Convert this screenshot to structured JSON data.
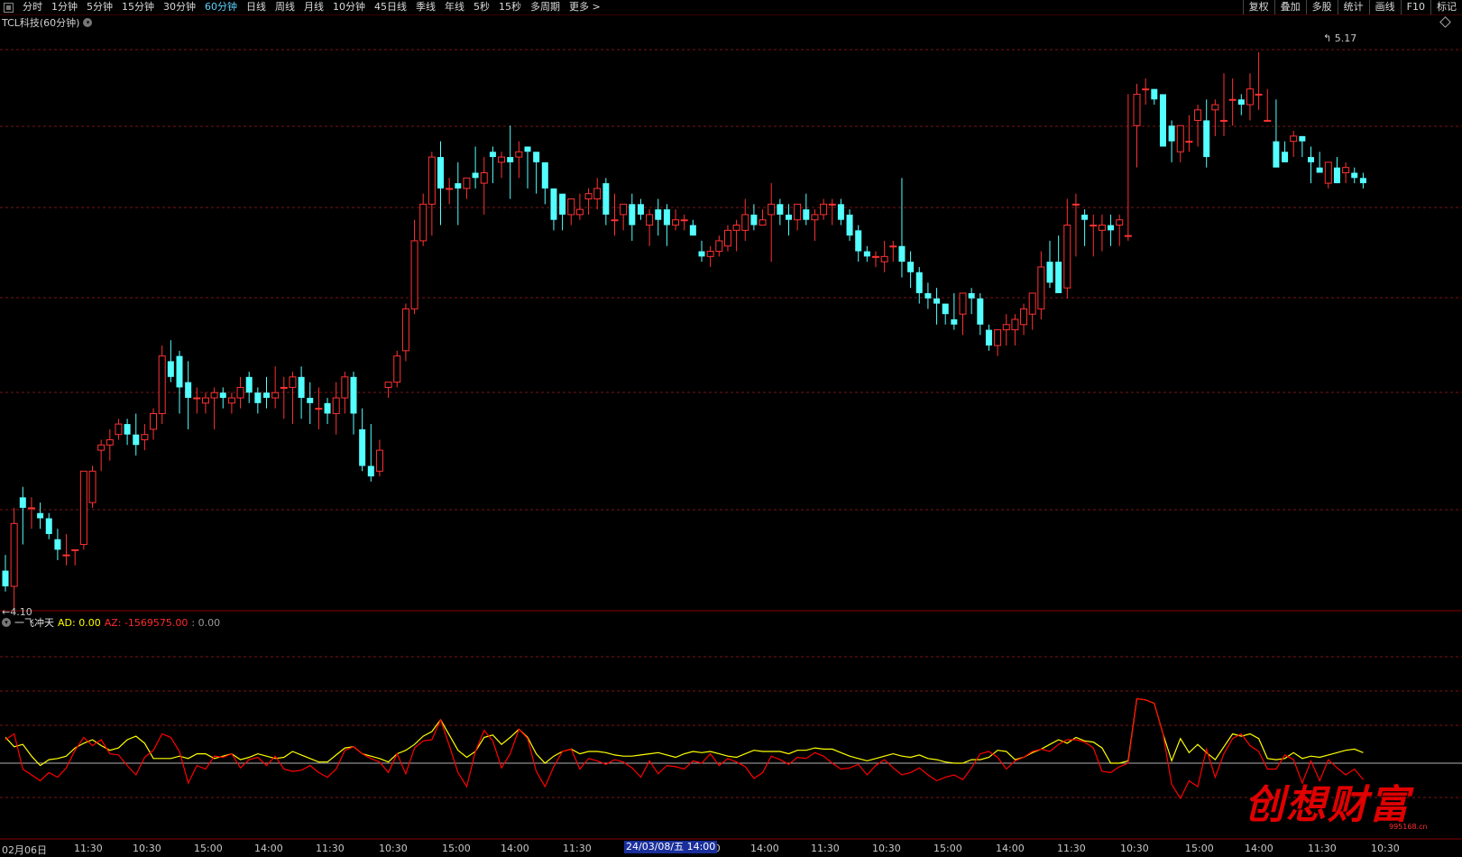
{
  "toolbar": {
    "tabs": [
      "分时",
      "1分钟",
      "5分钟",
      "15分钟",
      "30分钟",
      "60分钟",
      "日线",
      "周线",
      "月线",
      "10分钟",
      "45日线",
      "季线",
      "年线",
      "5秒",
      "15秒",
      "多周期",
      "更多 >"
    ],
    "active_tab": "60分钟",
    "right_buttons": [
      "复权",
      "叠加",
      "多股",
      "统计",
      "画线",
      "F10",
      "标记"
    ]
  },
  "title": "TCL科技(60分钟)",
  "price_high_label": "5.17",
  "price_low_label": "←4.10",
  "indicator": {
    "name": "一飞冲天",
    "ad_label": "AD: 0.00",
    "az_label": "AZ: -1569575.00",
    "extra_label": ": 0.00"
  },
  "xaxis": {
    "labels": [
      "02月06日",
      "11:30",
      "10:30",
      "15:00",
      "14:00",
      "11:30",
      "10:30",
      "15:00",
      "14:00",
      "11:30",
      "15:00",
      "14:00",
      "11:30",
      "10:30",
      "15:00",
      "14:00",
      "11:30",
      "10:30",
      "15:00",
      "14:00",
      "11:30",
      "10:30"
    ],
    "date_flag": "24/03/08/五 14:00"
  },
  "watermark": {
    "text": "创想财富",
    "sub": "995168.cn"
  },
  "colors": {
    "up": "#ff3232",
    "down": "#54ffff",
    "ad_line": "#ffff00",
    "az_line": "#ff0000",
    "grid": "#7a1414"
  },
  "chart_data": {
    "type": "candlestick",
    "opens": [
      4.18,
      4.15,
      4.32,
      4.3,
      4.29,
      4.28,
      4.24,
      4.21,
      4.22,
      4.23,
      4.31,
      4.41,
      4.42,
      4.44,
      4.46,
      4.44,
      4.43,
      4.45,
      4.48,
      4.58,
      4.59,
      4.54,
      4.51,
      4.5,
      4.51,
      4.52,
      4.5,
      4.51,
      4.55,
      4.52,
      4.52,
      4.51,
      4.53,
      4.53,
      4.55,
      4.51,
      4.49,
      4.5,
      4.48,
      4.51,
      4.55,
      4.45,
      4.38,
      4.37,
      4.53,
      4.54,
      4.6,
      4.68,
      4.81,
      4.88,
      4.97,
      4.91,
      4.92,
      4.91,
      4.94,
      4.92,
      4.98,
      4.96,
      4.97,
      4.97,
      4.99,
      4.98,
      4.96,
      4.91,
      4.9,
      4.86,
      4.86,
      4.89,
      4.89,
      4.92,
      4.85,
      4.86,
      4.88,
      4.88,
      4.84,
      4.87,
      4.87,
      4.84,
      4.85,
      4.84,
      4.79,
      4.78,
      4.79,
      4.8,
      4.83,
      4.83,
      4.86,
      4.84,
      4.86,
      4.88,
      4.86,
      4.85,
      4.87,
      4.85,
      4.86,
      4.88,
      4.88,
      4.86,
      4.83,
      4.79,
      4.78,
      4.77,
      4.8,
      4.8,
      4.77,
      4.75,
      4.71,
      4.7,
      4.69,
      4.66,
      4.67,
      4.71,
      4.7,
      4.64,
      4.61,
      4.64,
      4.64,
      4.65,
      4.67,
      4.68,
      4.77,
      4.77,
      4.72,
      4.88,
      4.86,
      4.84,
      4.83,
      4.84,
      4.84,
      4.82,
      5.03,
      5.1,
      5.1,
      5.09,
      5.03,
      4.98,
      5.0,
      5.04,
      5.04,
      5.06,
      5.04,
      5.08,
      5.08,
      5.07,
      5.09,
      5.04,
      5.0,
      4.98,
      5.0,
      5.01,
      4.97,
      4.95,
      4.92,
      4.95,
      4.94,
      4.94,
      4.93
    ],
    "highs": [
      4.21,
      4.3,
      4.34,
      4.32,
      4.31,
      4.29,
      4.26,
      4.25,
      4.22,
      4.37,
      4.38,
      4.43,
      4.45,
      4.47,
      4.47,
      4.48,
      4.46,
      4.49,
      4.61,
      4.62,
      4.6,
      4.58,
      4.53,
      4.52,
      4.53,
      4.53,
      4.52,
      4.55,
      4.56,
      4.53,
      4.55,
      4.57,
      4.55,
      4.56,
      4.57,
      4.54,
      4.53,
      4.51,
      4.54,
      4.56,
      4.56,
      4.49,
      4.46,
      4.43,
      4.54,
      4.6,
      4.69,
      4.85,
      4.9,
      4.98,
      5.0,
      4.93,
      4.96,
      4.93,
      4.99,
      4.97,
      4.99,
      4.98,
      5.03,
      5.0,
      4.98,
      4.97,
      4.95,
      4.91,
      4.9,
      4.89,
      4.9,
      4.91,
      4.93,
      4.93,
      4.9,
      4.88,
      4.9,
      4.89,
      4.87,
      4.89,
      4.88,
      4.87,
      4.86,
      4.85,
      4.81,
      4.8,
      4.82,
      4.84,
      4.85,
      4.89,
      4.88,
      4.87,
      4.92,
      4.89,
      4.88,
      4.87,
      4.9,
      4.87,
      4.89,
      4.89,
      4.89,
      4.87,
      4.84,
      4.8,
      4.79,
      4.81,
      4.81,
      4.93,
      4.79,
      4.76,
      4.73,
      4.72,
      4.69,
      4.71,
      4.7,
      4.72,
      4.71,
      4.65,
      4.64,
      4.67,
      4.67,
      4.69,
      4.7,
      4.79,
      4.81,
      4.82,
      4.89,
      4.9,
      4.87,
      4.86,
      4.86,
      4.86,
      4.86,
      5.09,
      5.11,
      5.12,
      5.1,
      5.08,
      5.04,
      5.02,
      5.05,
      5.07,
      5.08,
      5.08,
      5.13,
      5.12,
      5.09,
      5.13,
      5.17,
      5.1,
      5.08,
      5.0,
      5.02,
      5.01,
      4.99,
      4.98,
      4.95,
      4.97,
      4.96,
      4.95,
      4.94
    ],
    "lows": [
      4.14,
      4.1,
      4.23,
      4.26,
      4.26,
      4.24,
      4.2,
      4.19,
      4.19,
      4.22,
      4.3,
      4.37,
      4.39,
      4.43,
      4.42,
      4.4,
      4.41,
      4.43,
      4.46,
      4.54,
      4.48,
      4.45,
      4.48,
      4.48,
      4.45,
      4.49,
      4.48,
      4.49,
      4.5,
      4.48,
      4.49,
      4.49,
      4.47,
      4.46,
      4.47,
      4.46,
      4.45,
      4.46,
      4.44,
      4.48,
      4.44,
      4.37,
      4.35,
      4.36,
      4.51,
      4.53,
      4.58,
      4.67,
      4.8,
      4.82,
      4.84,
      4.88,
      4.84,
      4.89,
      4.91,
      4.86,
      4.92,
      4.93,
      4.89,
      4.93,
      4.91,
      4.9,
      4.88,
      4.83,
      4.83,
      4.84,
      4.85,
      4.86,
      4.87,
      4.84,
      4.82,
      4.83,
      4.81,
      4.85,
      4.8,
      4.82,
      4.8,
      4.83,
      4.83,
      4.82,
      4.77,
      4.76,
      4.78,
      4.79,
      4.79,
      4.81,
      4.83,
      4.84,
      4.77,
      4.84,
      4.82,
      4.83,
      4.84,
      4.81,
      4.85,
      4.84,
      4.84,
      4.81,
      4.77,
      4.77,
      4.76,
      4.75,
      4.77,
      4.74,
      4.72,
      4.69,
      4.68,
      4.65,
      4.65,
      4.64,
      4.63,
      4.67,
      4.63,
      4.6,
      4.59,
      4.61,
      4.61,
      4.63,
      4.64,
      4.66,
      4.72,
      4.71,
      4.7,
      4.78,
      4.8,
      4.78,
      4.79,
      4.8,
      4.8,
      4.81,
      4.95,
      5.07,
      5.07,
      4.99,
      4.96,
      4.96,
      4.98,
      4.99,
      4.95,
      5.01,
      5.01,
      5.03,
      5.05,
      5.04,
      5.06,
      5.04,
      4.98,
      4.96,
      4.97,
      4.97,
      4.92,
      4.95,
      4.91,
      4.92,
      4.92,
      4.92,
      4.91
    ],
    "closes": [
      4.15,
      4.27,
      4.3,
      4.3,
      4.28,
      4.25,
      4.22,
      4.21,
      4.22,
      4.37,
      4.37,
      4.42,
      4.43,
      4.46,
      4.44,
      4.42,
      4.44,
      4.48,
      4.59,
      4.55,
      4.53,
      4.51,
      4.51,
      4.51,
      4.52,
      4.51,
      4.51,
      4.53,
      4.52,
      4.5,
      4.51,
      4.52,
      4.53,
      4.55,
      4.51,
      4.5,
      4.49,
      4.48,
      4.51,
      4.55,
      4.48,
      4.38,
      4.36,
      4.41,
      4.54,
      4.59,
      4.68,
      4.81,
      4.88,
      4.97,
      4.91,
      4.91,
      4.91,
      4.93,
      4.93,
      4.94,
      4.97,
      4.97,
      4.96,
      4.98,
      4.98,
      4.96,
      4.91,
      4.85,
      4.86,
      4.89,
      4.87,
      4.9,
      4.91,
      4.86,
      4.85,
      4.88,
      4.84,
      4.86,
      4.86,
      4.85,
      4.84,
      4.85,
      4.85,
      4.82,
      4.78,
      4.79,
      4.81,
      4.83,
      4.84,
      4.86,
      4.84,
      4.85,
      4.88,
      4.86,
      4.85,
      4.88,
      4.85,
      4.86,
      4.88,
      4.88,
      4.85,
      4.82,
      4.79,
      4.78,
      4.78,
      4.78,
      4.8,
      4.77,
      4.75,
      4.71,
      4.7,
      4.69,
      4.67,
      4.65,
      4.71,
      4.7,
      4.65,
      4.61,
      4.64,
      4.65,
      4.66,
      4.68,
      4.71,
      4.76,
      4.73,
      4.71,
      4.84,
      4.88,
      4.85,
      4.84,
      4.84,
      4.83,
      4.85,
      4.82,
      5.09,
      5.1,
      5.08,
      4.99,
      5.0,
      5.03,
      5.0,
      5.06,
      4.97,
      5.07,
      5.04,
      5.08,
      5.07,
      5.1,
      5.09,
      5.04,
      4.95,
      4.96,
      5.01,
      5.0,
      4.96,
      4.94,
      4.96,
      4.92,
      4.95,
      4.93,
      4.92
    ],
    "ad_values": [
      0.22,
      0.14,
      0.16,
      0.06,
      -0.02,
      0.03,
      0.04,
      0.06,
      0.13,
      0.17,
      0.2,
      0.15,
      0.11,
      0.13,
      0.2,
      0.23,
      0.17,
      0.04,
      0.04,
      0.04,
      0.06,
      0.04,
      0.08,
      0.08,
      0.04,
      0.06,
      0.08,
      0.03,
      0.05,
      0.08,
      0.06,
      0.04,
      0.05,
      0.1,
      0.07,
      0.04,
      0.01,
      0.01,
      0.07,
      0.13,
      0.14,
      0.08,
      0.06,
      0.04,
      0.01,
      0.08,
      0.11,
      0.16,
      0.23,
      0.27,
      0.37,
      0.24,
      0.11,
      0.05,
      0.1,
      0.22,
      0.24,
      0.16,
      0.22,
      0.29,
      0.22,
      0.08,
      0.0,
      0.06,
      0.1,
      0.12,
      0.08,
      0.1,
      0.1,
      0.09,
      0.07,
      0.06,
      0.06,
      0.07,
      0.08,
      0.09,
      0.07,
      0.05,
      0.08,
      0.1,
      0.09,
      0.1,
      0.08,
      0.06,
      0.05,
      0.08,
      0.11,
      0.1,
      0.1,
      0.1,
      0.08,
      0.11,
      0.11,
      0.13,
      0.12,
      0.12,
      0.09,
      0.06,
      0.04,
      0.02,
      0.04,
      0.06,
      0.08,
      0.06,
      0.05,
      0.07,
      0.04,
      0.03,
      0.01,
      0.0,
      0.0,
      0.03,
      0.03,
      0.05,
      0.11,
      0.1,
      0.03,
      0.05,
      0.09,
      0.12,
      0.16,
      0.2,
      0.17,
      0.22,
      0.19,
      0.18,
      0.13,
      0.0,
      0.0,
      0.02,
      0.55,
      0.54,
      0.51,
      0.25,
      0.02,
      0.21,
      0.09,
      0.16,
      0.09,
      0.03,
      0.14,
      0.25,
      0.23,
      0.25,
      0.21,
      0.04,
      0.03,
      0.04,
      0.09,
      0.04,
      0.06,
      0.05,
      0.07,
      0.09,
      0.11,
      0.12,
      0.09
    ],
    "az_values": [
      0.2,
      0.25,
      -0.05,
      -0.1,
      -0.15,
      -0.08,
      -0.12,
      -0.04,
      0.11,
      0.22,
      0.15,
      0.2,
      0.08,
      0.07,
      -0.02,
      -0.1,
      0.05,
      0.11,
      0.25,
      0.22,
      0.1,
      -0.17,
      -0.02,
      -0.05,
      0.06,
      0.05,
      0.08,
      -0.04,
      0.03,
      0.05,
      -0.02,
      0.06,
      -0.05,
      -0.07,
      -0.06,
      -0.02,
      -0.08,
      -0.12,
      -0.05,
      0.11,
      0.14,
      0.08,
      0.04,
      0.01,
      -0.08,
      0.08,
      -0.09,
      0.13,
      0.19,
      0.2,
      0.37,
      0.15,
      -0.08,
      -0.2,
      0.1,
      0.28,
      0.19,
      -0.04,
      0.08,
      0.29,
      0.21,
      -0.07,
      -0.2,
      -0.03,
      0.1,
      0.12,
      -0.05,
      0.04,
      0.02,
      -0.01,
      0.03,
      0.01,
      -0.04,
      -0.12,
      0.02,
      -0.09,
      -0.02,
      -0.03,
      -0.05,
      0.02,
      0.0,
      0.08,
      -0.02,
      0.04,
      0.01,
      -0.03,
      -0.13,
      -0.08,
      0.06,
      0.03,
      -0.01,
      0.05,
      0.04,
      0.09,
      0.06,
      0.0,
      -0.05,
      -0.04,
      -0.01,
      -0.1,
      -0.02,
      0.03,
      -0.04,
      -0.1,
      -0.08,
      -0.04,
      -0.1,
      -0.15,
      -0.12,
      -0.1,
      -0.14,
      -0.04,
      0.08,
      0.1,
      0.05,
      -0.05,
      0.02,
      0.05,
      0.1,
      0.12,
      0.1,
      0.16,
      0.2,
      0.2,
      0.18,
      0.13,
      -0.07,
      -0.08,
      -0.03,
      0.0,
      0.55,
      0.54,
      0.51,
      0.25,
      -0.18,
      -0.3,
      -0.15,
      -0.2,
      0.12,
      -0.12,
      0.08,
      0.21,
      0.25,
      0.15,
      0.1,
      -0.05,
      -0.05,
      0.07,
      0.03,
      -0.17,
      0.02,
      -0.15,
      0.03,
      -0.04,
      -0.1,
      -0.05,
      -0.14
    ]
  }
}
